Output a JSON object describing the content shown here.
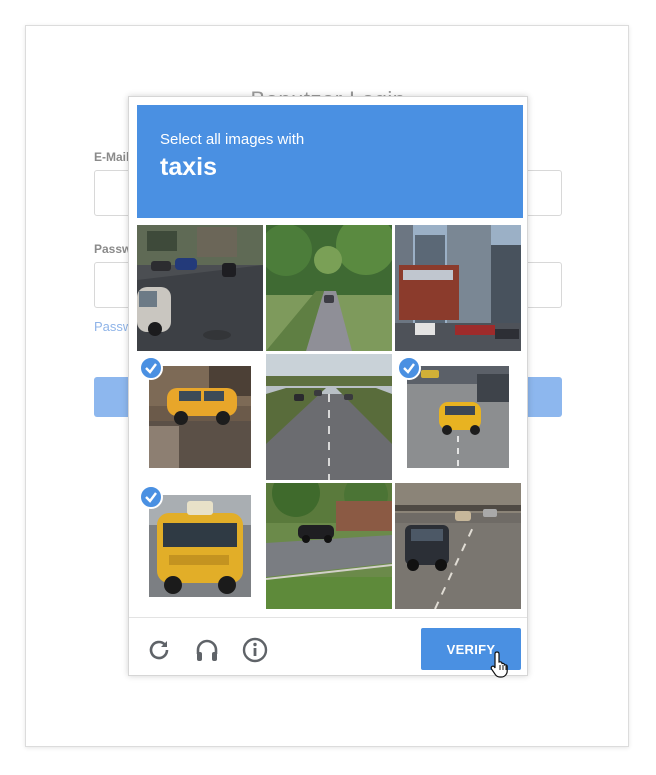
{
  "login": {
    "title": "Benutzer Login",
    "email_label": "E-Mail",
    "password_label": "Passwort",
    "forgot_link": "Passwort vergessen?"
  },
  "captcha": {
    "instruction": "Select all images with",
    "target": "taxis",
    "verify_label": "VERIFY",
    "tiles": [
      {
        "scene": "street with parked cars",
        "selected": false
      },
      {
        "scene": "tree-lined road",
        "selected": false
      },
      {
        "scene": "city buildings",
        "selected": false
      },
      {
        "scene": "yellow taxi",
        "selected": true
      },
      {
        "scene": "highway",
        "selected": false
      },
      {
        "scene": "yellow taxi on street",
        "selected": true
      },
      {
        "scene": "yellow taxi close-up",
        "selected": true
      },
      {
        "scene": "residential street",
        "selected": false
      },
      {
        "scene": "road traffic",
        "selected": false
      }
    ],
    "footer_icons": [
      "reload-icon",
      "headphones-icon",
      "info-icon"
    ]
  },
  "colors": {
    "accent": "#4a90e2",
    "taxi_yellow": "#e8b321"
  }
}
